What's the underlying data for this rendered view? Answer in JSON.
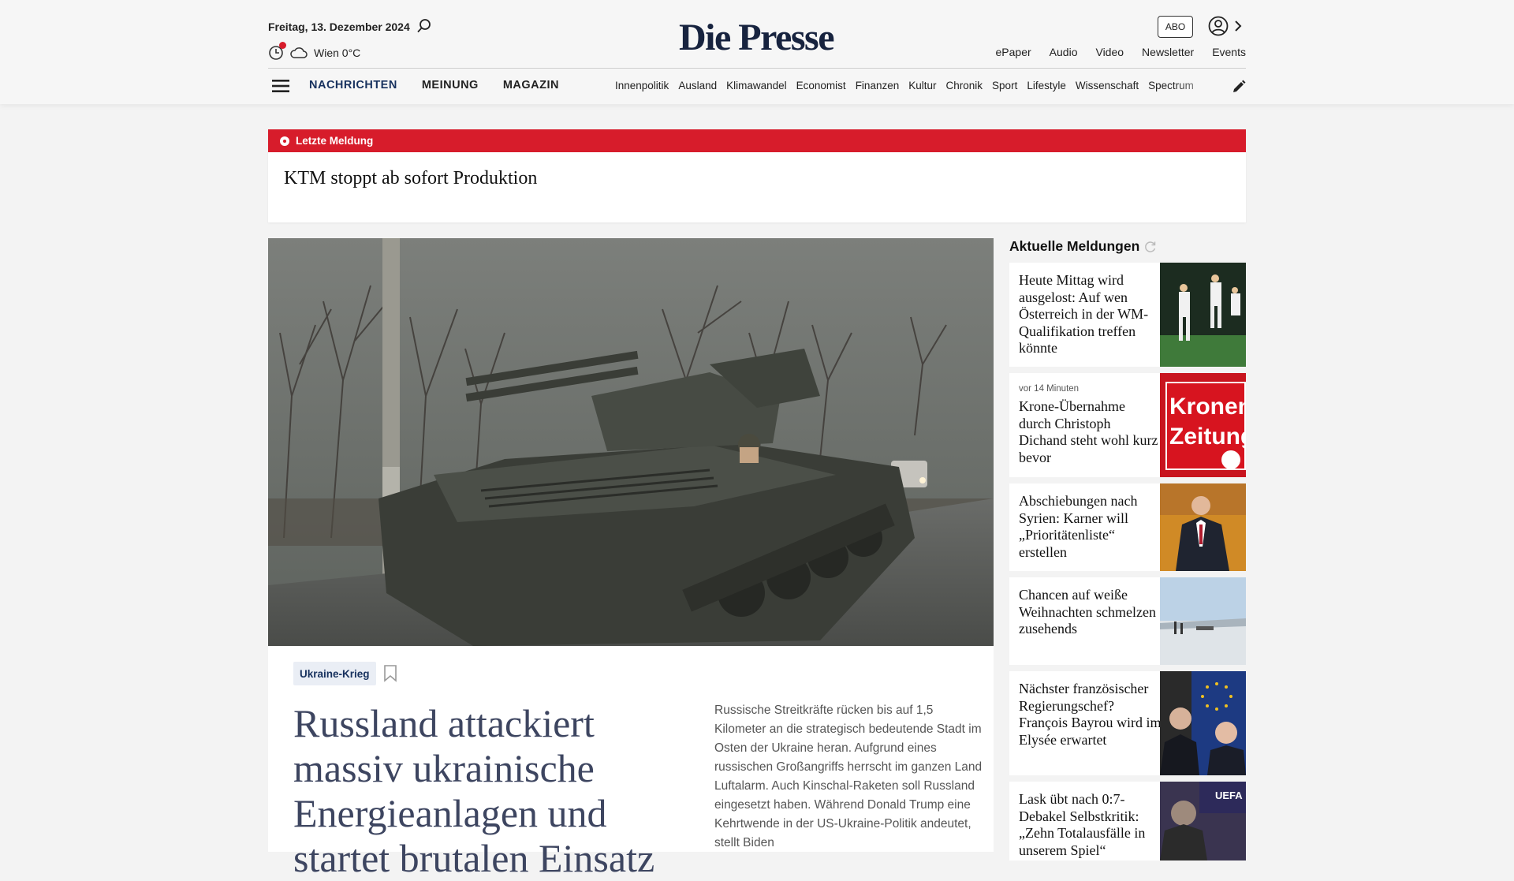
{
  "header": {
    "date": "Freitag, 13. Dezember 2024",
    "weather": "Wien 0°C",
    "logo": "Die Presse",
    "abo_label": "ABO",
    "top_links": [
      "ePaper",
      "Audio",
      "Video",
      "Newsletter",
      "Events"
    ],
    "nav_main": [
      "NACHRICHTEN",
      "MEINUNG",
      "MAGAZIN"
    ],
    "nav_sub": [
      "Innenpolitik",
      "Ausland",
      "Klimawandel",
      "Economist",
      "Finanzen",
      "Kultur",
      "Chronik",
      "Sport",
      "Lifestyle",
      "Wissenschaft",
      "Spectrum"
    ],
    "colors": {
      "brand": "#17233f",
      "nav_active": "#17315e",
      "alert": "#d71c2b"
    }
  },
  "breaking": {
    "label": "Letzte Meldung",
    "headline": "KTM stoppt ab sofort Produktion"
  },
  "lead": {
    "tag": "Ukraine-Krieg",
    "title": "Russland attackiert massiv ukrainische Energieanlagen und startet brutalen Einsatz",
    "teaser": "Russische Streitkräfte rücken bis auf 1,5 Kilometer an die strategisch bedeutende Stadt im Osten der Ukraine heran. Aufgrund eines russischen Großangriffs herrscht im ganzen Land Luftalarm. Auch Kinschal-Raketen soll Russland eingesetzt haben. Während Donald Trump eine Kehrtwende in der US-Ukraine-Politik andeutet, stellt Biden"
  },
  "sidebar": {
    "title": "Aktuelle Meldungen",
    "items": [
      {
        "time": "",
        "headline": "Heute Mittag wird ausgelost: Auf wen Österreich in der WM-Qualifikation treffen könnte",
        "thumb": "football-players-photo"
      },
      {
        "time": "vor 14 Minuten",
        "headline": "Krone-Übernahme durch Christoph Dichand steht wohl kurz bevor",
        "thumb": "kronen-zeitung-sign-photo",
        "thumb_text": [
          "Kronen",
          "Zeitung"
        ]
      },
      {
        "time": "",
        "headline": "Abschiebungen nach Syrien: Karner will „Prioritätenliste“ erstellen",
        "thumb": "politician-photo"
      },
      {
        "time": "",
        "headline": "Chancen auf weiße Weihnachten schmelzen zusehends",
        "thumb": "winter-landscape-photo"
      },
      {
        "time": "",
        "headline": "Nächster französischer Regierungschef? François Bayrou wird im Elysée erwartet",
        "thumb": "bayrou-macron-photo"
      },
      {
        "time": "",
        "headline": "Lask übt nach 0:7-Debakel Selbstkritik: „Zehn Totalausfälle in unserem Spiel“",
        "thumb": "football-coach-photo",
        "thumb_text": [
          "UEFA"
        ]
      }
    ]
  }
}
